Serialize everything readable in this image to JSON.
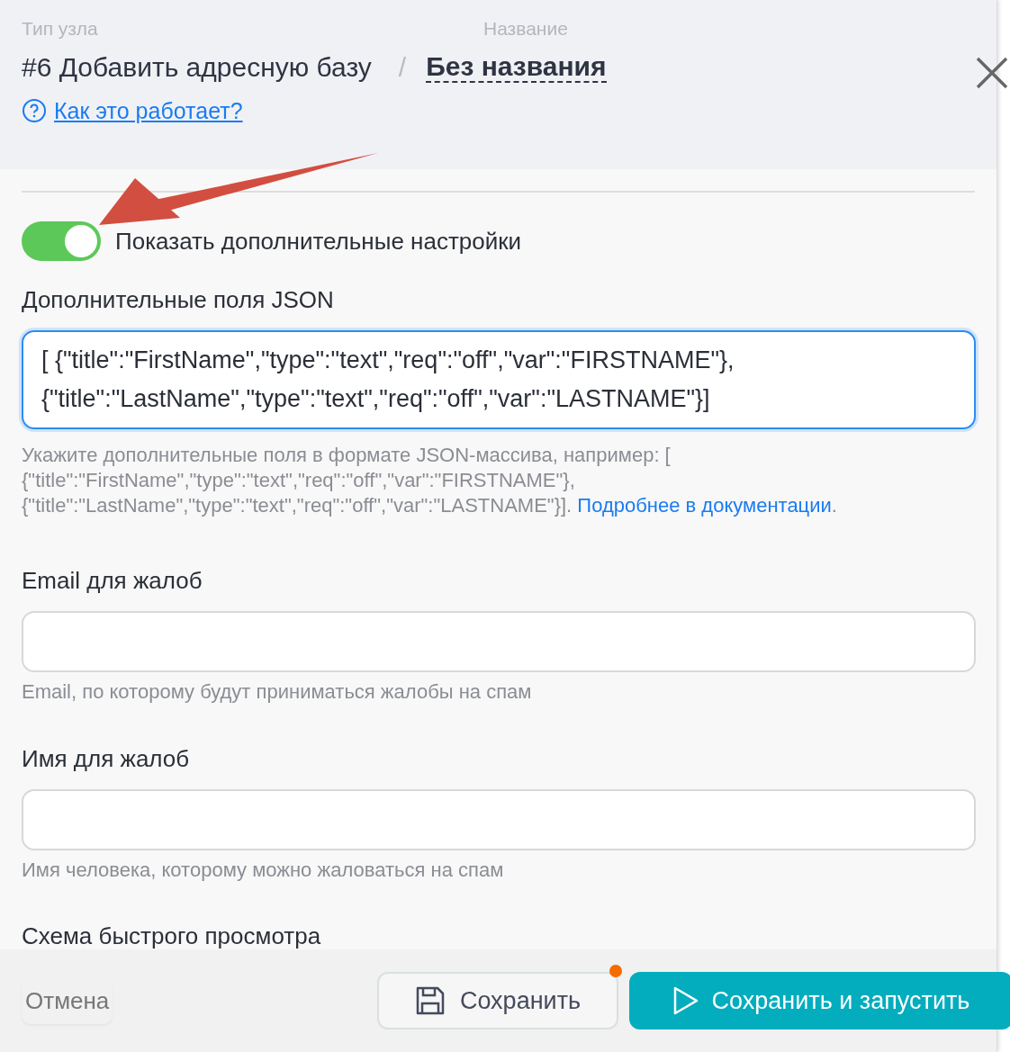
{
  "header": {
    "type_label": "Тип узла",
    "type_value": "#6 Добавить адресную базу",
    "separator": "/",
    "name_label": "Название",
    "name_value": "Без названия",
    "help_link": "Как это работает?"
  },
  "toggle": {
    "label": "Показать дополнительные настройки",
    "on": true
  },
  "fields": [
    {
      "kind": "textarea",
      "label": "Дополнительные поля JSON",
      "value": "[ {\"title\":\"FirstName\",\"type\":\"text\",\"req\":\"off\",\"var\":\"FIRSTNAME\"},\n{\"title\":\"LastName\",\"type\":\"text\",\"req\":\"off\",\"var\":\"LASTNAME\"}]",
      "focused": true,
      "help": "Укажите дополнительные поля в формате JSON-массива, например: [ {\"title\":\"FirstName\",\"type\":\"text\",\"req\":\"off\",\"var\":\"FIRSTNAME\"}, {\"title\":\"LastName\",\"type\":\"text\",\"req\":\"off\",\"var\":\"LASTNAME\"}].",
      "help_link": "Подробнее в документации",
      "help_end": "."
    },
    {
      "kind": "input",
      "label": "Email для жалоб",
      "focused": false,
      "help": "Email, по которому будут приниматься жалобы на спам"
    },
    {
      "kind": "input",
      "label": "Имя для жалоб",
      "focused": false,
      "help": "Имя человека, которому можно жаловаться на спам"
    }
  ],
  "next_section": "Схема быстрого просмотра",
  "footer": {
    "cancel": "Отмена",
    "save": "Сохранить",
    "unsaved": true,
    "run": "Сохранить и запустить"
  }
}
